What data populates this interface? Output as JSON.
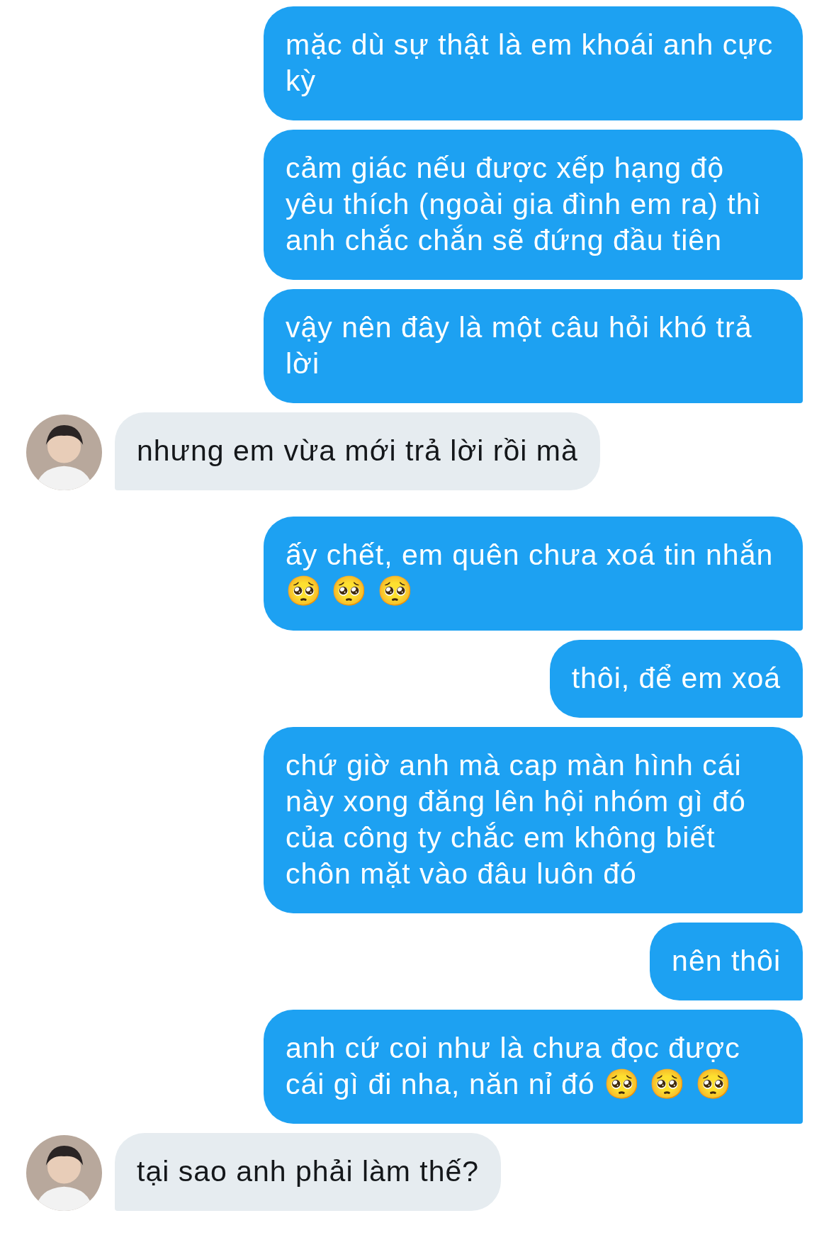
{
  "messages": [
    {
      "kind": "sent",
      "text": "mặc dù sự thật là em khoái anh cực kỳ"
    },
    {
      "kind": "sent",
      "text": "cảm giác nếu được xếp hạng độ yêu thích (ngoài gia đình em ra) thì anh chắc chắn sẽ đứng đầu tiên"
    },
    {
      "kind": "sent",
      "text": "vậy nên đây là một câu hỏi khó trả lời"
    },
    {
      "kind": "received",
      "text": "nhưng em vừa mới trả lời rồi mà"
    },
    {
      "kind": "sent",
      "text": "ấy chết, em quên chưa xoá tin nhắn 🥺 🥺 🥺"
    },
    {
      "kind": "sent",
      "text": "thôi, để em xoá"
    },
    {
      "kind": "sent",
      "text": "chứ giờ anh mà cap màn hình cái này xong đăng lên hội nhóm gì đó của công ty chắc em không biết chôn mặt vào đâu luôn đó"
    },
    {
      "kind": "sent",
      "text": "nên thôi"
    },
    {
      "kind": "sent",
      "text": "anh cứ coi như là chưa đọc được cái gì đi nha, năn nỉ đó 🥺 🥺 🥺"
    },
    {
      "kind": "received",
      "text": "tại sao anh phải làm thế?"
    }
  ]
}
